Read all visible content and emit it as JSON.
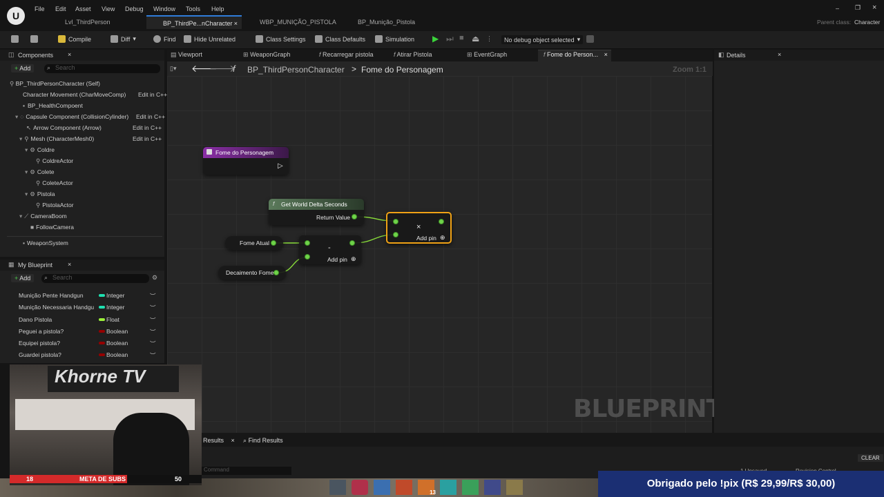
{
  "menu": [
    "File",
    "Edit",
    "Asset",
    "View",
    "Debug",
    "Window",
    "Tools",
    "Help"
  ],
  "tabs": [
    "Lvl_ThirdPerson",
    "BP_ThirdPe...nCharacter",
    "WBP_MUNIÇÃO_PISTOLA",
    "BP_Munição_Pistola"
  ],
  "parent_class_label": "Parent class:",
  "parent_class_value": "Character",
  "toolbar": {
    "compile": "Compile",
    "diff": "Diff",
    "find": "Find",
    "hide_unrelated": "Hide Unrelated",
    "class_settings": "Class Settings",
    "class_defaults": "Class Defaults",
    "simulation": "Simulation",
    "debug_object": "No debug object selected"
  },
  "components": {
    "title": "Components",
    "add": "Add",
    "search_placeholder": "Search",
    "root": "BP_ThirdPersonCharacter (Self)",
    "items": [
      {
        "label": "Character Movement (CharMoveComp)",
        "edit": "Edit in C++"
      },
      {
        "label": "BP_HealthCompoent",
        "edit": ""
      },
      {
        "label": "Capsule Component (CollisionCylinder)",
        "edit": "Edit in C++"
      },
      {
        "label": "Arrow Component (Arrow)",
        "edit": "Edit in C++"
      },
      {
        "label": "Mesh (CharacterMesh0)",
        "edit": "Edit in C++"
      },
      {
        "label": "Coldre",
        "edit": ""
      },
      {
        "label": "ColdreActor",
        "edit": ""
      },
      {
        "label": "Colete",
        "edit": ""
      },
      {
        "label": "ColeteActor",
        "edit": ""
      },
      {
        "label": "Pistola",
        "edit": ""
      },
      {
        "label": "PistolaActor",
        "edit": ""
      },
      {
        "label": "CameraBoom",
        "edit": ""
      },
      {
        "label": "FollowCamera",
        "edit": ""
      },
      {
        "label": "WeaponSystem",
        "edit": ""
      }
    ]
  },
  "my_blueprint": {
    "title": "My Blueprint",
    "add": "Add",
    "search_placeholder": "Search",
    "vars": [
      {
        "name": "Munição Pente Handgun",
        "type": "Integer",
        "color": "#1fe0b0"
      },
      {
        "name": "Munição Necessaria Handgu",
        "type": "Integer",
        "color": "#1fe0b0"
      },
      {
        "name": "Dano Pistola",
        "type": "Float",
        "color": "#9bef3a"
      },
      {
        "name": "Peguei a pistola?",
        "type": "Boolean",
        "color": "#950000"
      },
      {
        "name": "Equipei pistola?",
        "type": "Boolean",
        "color": "#950000"
      },
      {
        "name": "Guardei pistola?",
        "type": "Boolean",
        "color": "#950000"
      }
    ]
  },
  "graph_tabs": [
    "Viewport",
    "WeaponGraph",
    "Recarregar pistola",
    "Atirar Pistola",
    "EventGraph",
    "Fome do Person..."
  ],
  "breadcrumb": {
    "root": "BP_ThirdPersonCharacter",
    "sep": ">",
    "current": "Fome do Personagem"
  },
  "zoom": "Zoom 1:1",
  "watermark": "BLUEPRINT",
  "nodes": {
    "entry_title": "Fome do Personagem",
    "delta_title": "Get World Delta Seconds",
    "return_value": "Return Value",
    "fome_atual": "Fome Atual",
    "decaimento": "Decaimento Fome",
    "add_pin": "Add pin",
    "minus": "-",
    "mult": "×"
  },
  "details_title": "Details",
  "bottom": {
    "results": "Results",
    "find_results": "Find Results",
    "command_placeholder": "Command",
    "clear": "CLEAR",
    "unsaved": "1 Unsaved",
    "revision": "Revision Control"
  },
  "stream": {
    "meta_left": "18",
    "meta_label": "META DE SUBS",
    "meta_right": "50",
    "banner": "Obrigado pelo !pix (R$ 29,99/R$ 30,00)",
    "taskbar_badge": "13"
  }
}
